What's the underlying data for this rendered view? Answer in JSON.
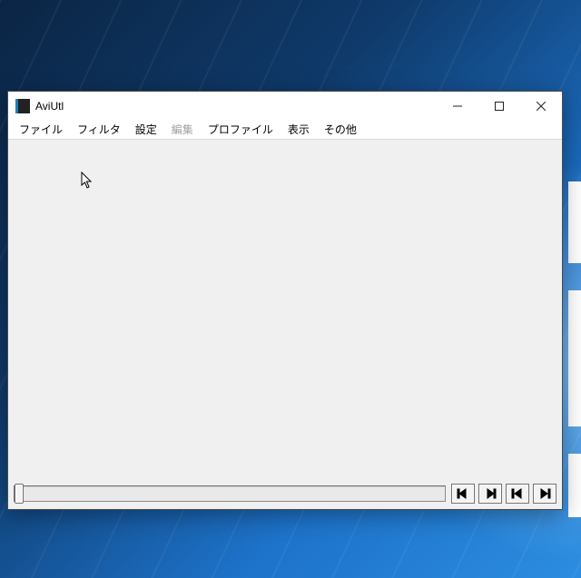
{
  "window": {
    "title": "AviUtl"
  },
  "menubar": {
    "items": [
      {
        "label": "ファイル",
        "enabled": true
      },
      {
        "label": "フィルタ",
        "enabled": true
      },
      {
        "label": "設定",
        "enabled": true
      },
      {
        "label": "編集",
        "enabled": false
      },
      {
        "label": "プロファイル",
        "enabled": true
      },
      {
        "label": "表示",
        "enabled": true
      },
      {
        "label": "その他",
        "enabled": true
      }
    ]
  },
  "controls": {
    "minimize_tooltip": "Minimize",
    "maximize_tooltip": "Maximize",
    "close_tooltip": "Close"
  },
  "playback": {
    "prev_frame": "Previous frame",
    "next_frame": "Next frame",
    "go_start": "Go to start",
    "go_end": "Go to end"
  }
}
